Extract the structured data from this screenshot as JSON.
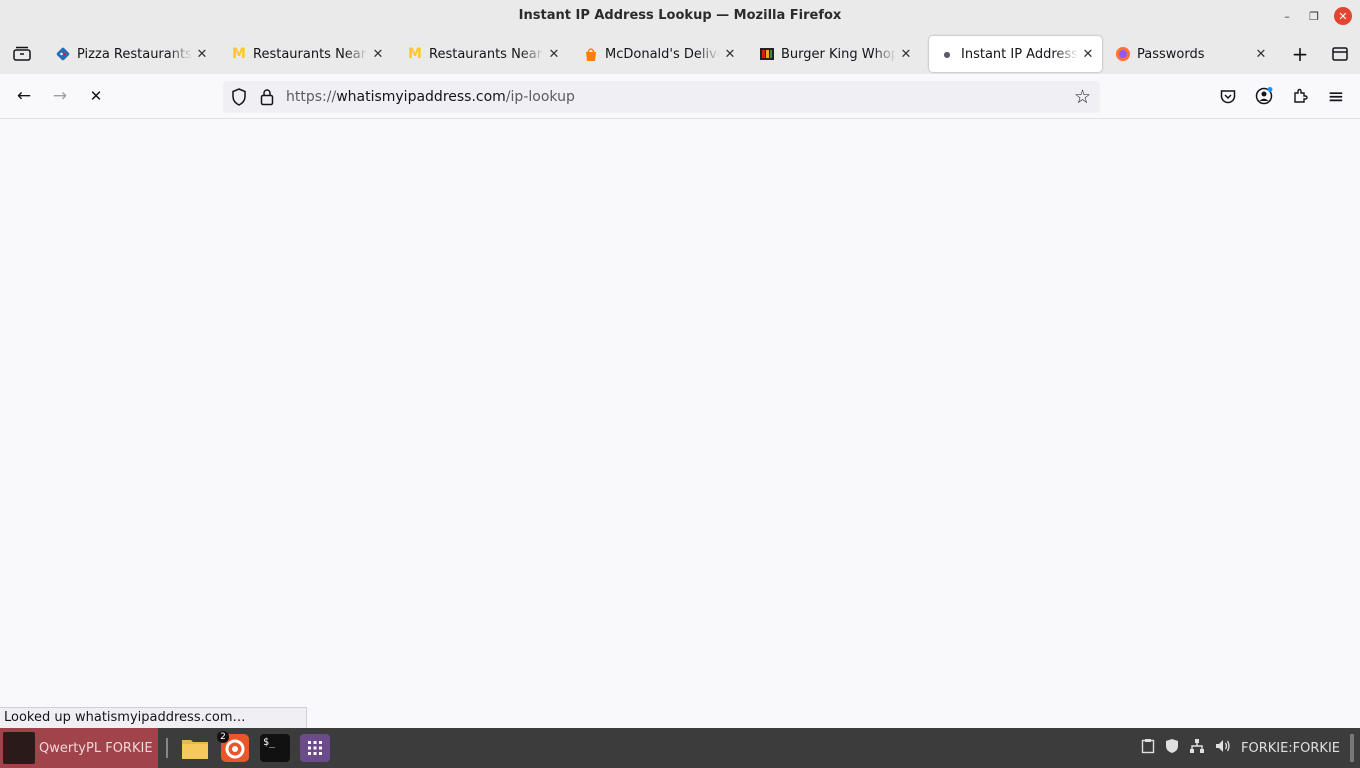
{
  "window": {
    "title": "Instant IP Address Lookup — Mozilla Firefox",
    "minimize_glyph": "–",
    "maximize_glyph": "❐",
    "close_glyph": "✕"
  },
  "tabs": [
    {
      "label": "Pizza Restaurants Near Me",
      "favicon": "pizza-favicon-icon",
      "active": false
    },
    {
      "label": "Restaurants Near Me",
      "favicon": "mcdonalds-favicon-icon",
      "active": false
    },
    {
      "label": "Restaurants Near Me",
      "favicon": "mcdonalds-favicon-icon",
      "active": false
    },
    {
      "label": "McDonald's Delivery",
      "favicon": "delivery-favicon-icon",
      "active": false
    },
    {
      "label": "Burger King Whopper",
      "favicon": "burger-favicon-icon",
      "active": false
    },
    {
      "label": "Instant IP Address Lookup",
      "favicon": "loading-dot-icon",
      "active": true
    },
    {
      "label": "Passwords",
      "favicon": "firefox-favicon-icon",
      "active": false
    }
  ],
  "tab_close_glyph": "✕",
  "new_tab_glyph": "+",
  "url": {
    "scheme": "https://",
    "host": "whatismyipaddress.com",
    "path": "/ip-lookup"
  },
  "nav": {
    "back_glyph": "←",
    "forward_glyph": "→",
    "stop_glyph": "✕",
    "star_glyph": "☆",
    "menu_glyph": "≡"
  },
  "status_text": "Looked up whatismyipaddress.com…",
  "taskbar": {
    "username": "QwertyPL FORKIE",
    "badge": "2",
    "hostname": "FORKIE:FORKIE",
    "terminal_glyph": "$_"
  },
  "colors": {
    "accent_close": "#e2442f",
    "taskbar_user": "#a1434a",
    "taskbar_bg": "#3c3c3c"
  }
}
